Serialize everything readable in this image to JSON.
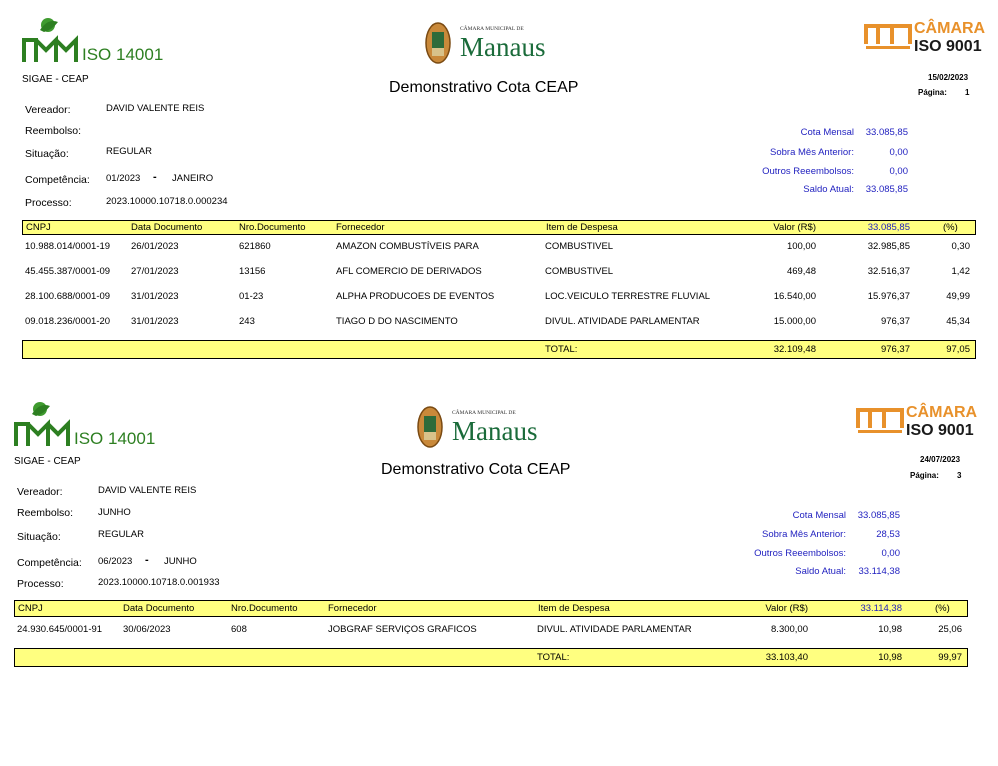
{
  "reports": [
    {
      "system": "SIGAE - CEAP",
      "title": "Demonstrativo Cota CEAP",
      "date": "15/02/2023",
      "page_label": "Página:",
      "page_num": "1",
      "logos": {
        "left": "ISO 14001",
        "center_top": "CÂMARA MUNICIPAL DE",
        "center": "Manaus",
        "right_top": "CÂMARA",
        "right": "ISO 9001"
      },
      "fields": {
        "vereador_label": "Vereador:",
        "vereador": "DAVID VALENTE REIS",
        "reembolso_label": "Reembolso:",
        "reembolso": "",
        "situacao_label": "Situação:",
        "situacao": "REGULAR",
        "competencia_label": "Competência:",
        "competencia": "01/2023",
        "competencia_sep": "-",
        "competencia_mes": "JANEIRO",
        "processo_label": "Processo:",
        "processo": "2023.10000.10718.0.000234"
      },
      "summary": {
        "cota_label": "Cota Mensal",
        "cota": "33.085,85",
        "sobra_label": "Sobra Mês Anterior:",
        "sobra": "0,00",
        "outros_label": "Outros Reeembolsos:",
        "outros": "0,00",
        "saldo_label": "Saldo Atual:",
        "saldo": "33.085,85"
      },
      "header": {
        "cnpj": "CNPJ",
        "data": "Data Documento",
        "nro": "Nro.Documento",
        "fornecedor": "Fornecedor",
        "item": "Item de Despesa",
        "valor": "Valor (R$)",
        "saldo": "33.085,85",
        "pct": "(%)"
      },
      "rows": [
        {
          "cnpj": "10.988.014/0001-19",
          "data": "26/01/2023",
          "nro": "621860",
          "fornecedor": "AMAZON COMBUSTÍVEIS PARA",
          "item": "COMBUSTIVEL",
          "valor": "100,00",
          "saldo": "32.985,85",
          "pct": "0,30"
        },
        {
          "cnpj": "45.455.387/0001-09",
          "data": "27/01/2023",
          "nro": "13156",
          "fornecedor": "AFL COMERCIO DE DERIVADOS",
          "item": "COMBUSTIVEL",
          "valor": "469,48",
          "saldo": "32.516,37",
          "pct": "1,42"
        },
        {
          "cnpj": "28.100.688/0001-09",
          "data": "31/01/2023",
          "nro": "01-23",
          "fornecedor": "ALPHA PRODUCOES DE EVENTOS",
          "item": "LOC.VEICULO TERRESTRE FLUVIAL",
          "valor": "16.540,00",
          "saldo": "15.976,37",
          "pct": "49,99"
        },
        {
          "cnpj": "09.018.236/0001-20",
          "data": "31/01/2023",
          "nro": "243",
          "fornecedor": "TIAGO D DO NASCIMENTO",
          "item": "DIVUL. ATIVIDADE PARLAMENTAR",
          "valor": "15.000,00",
          "saldo": "976,37",
          "pct": "45,34"
        }
      ],
      "total": {
        "label": "TOTAL:",
        "valor": "32.109,48",
        "saldo": "976,37",
        "pct": "97,05"
      }
    },
    {
      "system": "SIGAE - CEAP",
      "title": "Demonstrativo Cota CEAP",
      "date": "24/07/2023",
      "page_label": "Página:",
      "page_num": "3",
      "logos": {
        "left": "ISO 14001",
        "center_top": "CÂMARA MUNICIPAL DE",
        "center": "Manaus",
        "right_top": "CÂMARA",
        "right": "ISO 9001"
      },
      "fields": {
        "vereador_label": "Vereador:",
        "vereador": "DAVID VALENTE REIS",
        "reembolso_label": "Reembolso:",
        "reembolso": "JUNHO",
        "situacao_label": "Situação:",
        "situacao": "REGULAR",
        "competencia_label": "Competência:",
        "competencia": "06/2023",
        "competencia_sep": "-",
        "competencia_mes": "JUNHO",
        "processo_label": "Processo:",
        "processo": "2023.10000.10718.0.001933"
      },
      "summary": {
        "cota_label": "Cota Mensal",
        "cota": "33.085,85",
        "sobra_label": "Sobra Mês Anterior:",
        "sobra": "28,53",
        "outros_label": "Outros Reeembolsos:",
        "outros": "0,00",
        "saldo_label": "Saldo Atual:",
        "saldo": "33.114,38"
      },
      "header": {
        "cnpj": "CNPJ",
        "data": "Data Documento",
        "nro": "Nro.Documento",
        "fornecedor": "Fornecedor",
        "item": "Item de Despesa",
        "valor": "Valor (R$)",
        "saldo": "33.114,38",
        "pct": "(%)"
      },
      "rows": [
        {
          "cnpj": "24.930.645/0001-91",
          "data": "30/06/2023",
          "nro": "608",
          "fornecedor": "JOBGRAF SERVIÇOS GRAFICOS",
          "item": "DIVUL. ATIVIDADE PARLAMENTAR",
          "valor": "8.300,00",
          "saldo": "10,98",
          "pct": "25,06"
        }
      ],
      "total": {
        "label": "TOTAL:",
        "valor": "33.103,40",
        "saldo": "10,98",
        "pct": "99,97"
      }
    }
  ]
}
